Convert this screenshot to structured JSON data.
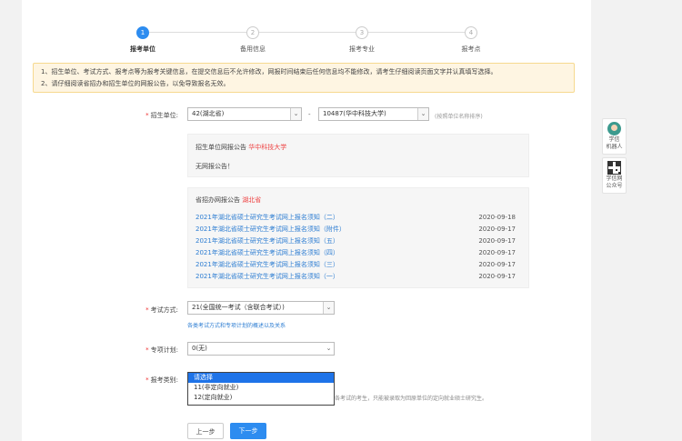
{
  "steps": [
    {
      "num": "1",
      "label": "报考单位",
      "active": true
    },
    {
      "num": "2",
      "label": "备用信息",
      "active": false
    },
    {
      "num": "3",
      "label": "报考专业",
      "active": false
    },
    {
      "num": "4",
      "label": "报考点",
      "active": false
    }
  ],
  "notice": {
    "line1": "1、招生单位、考试方式、报考点等为报考关键信息，在提交信息后不允许修改，网报时间结束后任何信息均不能修改，请考生仔细阅读页面文字并认真填写选择。",
    "line2": "2、请仔细阅读省招办和招生单位的网报公告，以免导致报名无效。"
  },
  "unit": {
    "label": "招生单位:",
    "province": "42(湖北省)",
    "separator": "-",
    "school": "10487(华中科技大学)",
    "hint": "(按照单位名称排序)"
  },
  "school_panel": {
    "title_prefix": "招生单位网报公告",
    "title_name": "华中科技大学",
    "body": "无网报公告！"
  },
  "province_panel": {
    "title_prefix": "省招办网报公告",
    "title_name": "湖北省",
    "items": [
      {
        "title": "2021年湖北省硕士研究生考试网上报名须知（二）",
        "date": "2020-09-18"
      },
      {
        "title": "2021年湖北省硕士研究生考试网上报名须知（附件）",
        "date": "2020-09-17"
      },
      {
        "title": "2021年湖北省硕士研究生考试网上报名须知（五）",
        "date": "2020-09-17"
      },
      {
        "title": "2021年湖北省硕士研究生考试网上报名须知（四）",
        "date": "2020-09-17"
      },
      {
        "title": "2021年湖北省硕士研究生考试网上报名须知（三）",
        "date": "2020-09-17"
      },
      {
        "title": "2021年湖北省硕士研究生考试网上报名须知（一）",
        "date": "2020-09-17"
      }
    ]
  },
  "exam_mode": {
    "label": "考试方式:",
    "value": "21(全国统一考试（含联合考试）)",
    "link": "各类考试方式和专项计划的概述以及关系"
  },
  "special_plan": {
    "label": "专项计划:",
    "value": "0(无)"
  },
  "category": {
    "label": "报考类别:",
    "options": [
      "请选择",
      "11(非定向就业)",
      "12(定向就业)"
    ],
    "selected_index": 0,
    "hidden_note": "各考试的考生，只能被录取为回原单位的定向就业硕士研究生。"
  },
  "buttons": {
    "prev": "上一步",
    "next": "下一步"
  },
  "side": {
    "robot_label": [
      "学信",
      "机器人"
    ],
    "qr_label": [
      "学信网",
      "公众号"
    ]
  },
  "colors": {
    "primary": "#2d8cf0",
    "link": "#2d7dd2",
    "accent_red": "#e44",
    "notice_bg": "#fef5e2"
  }
}
